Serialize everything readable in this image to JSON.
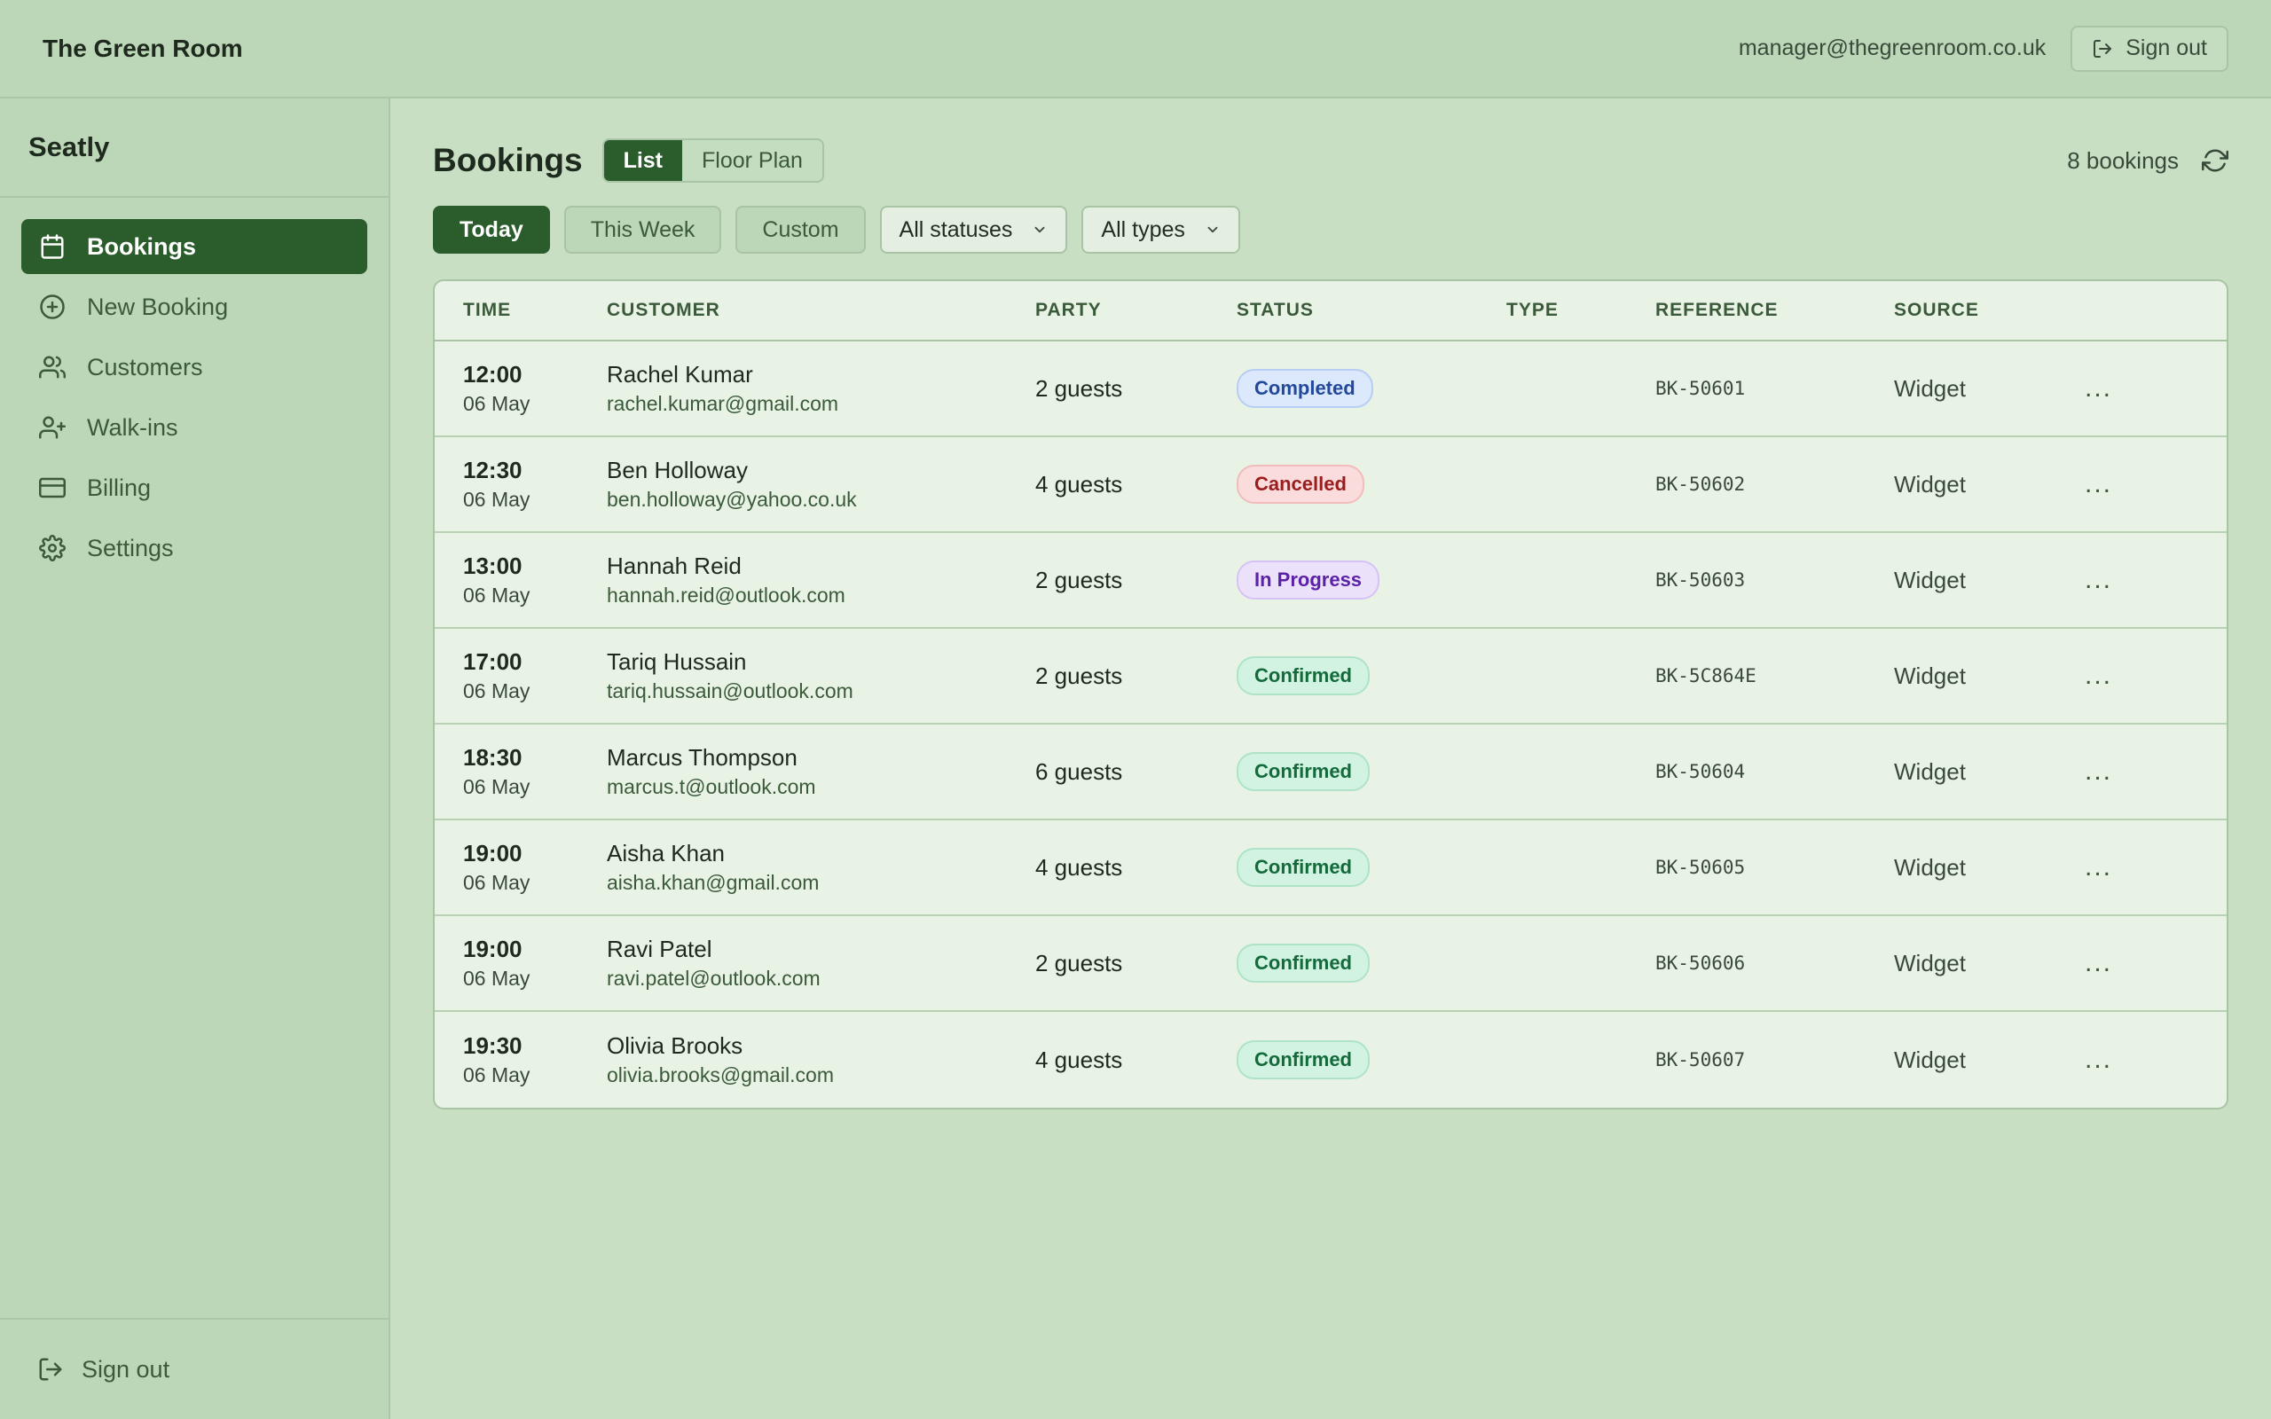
{
  "topbar": {
    "brand": "The Green Room",
    "user_email": "manager@thegreenroom.co.uk",
    "sign_out": "Sign out"
  },
  "sidebar": {
    "app_name": "Seatly",
    "items": [
      {
        "label": "Bookings",
        "icon": "calendar-icon",
        "active": true
      },
      {
        "label": "New Booking",
        "icon": "plus-circle-icon"
      },
      {
        "label": "Customers",
        "icon": "users-icon"
      },
      {
        "label": "Walk-ins",
        "icon": "user-plus-icon"
      },
      {
        "label": "Billing",
        "icon": "credit-card-icon"
      },
      {
        "label": "Settings",
        "icon": "gear-icon"
      }
    ],
    "sign_out": "Sign out"
  },
  "header": {
    "title": "Bookings",
    "views": [
      "List",
      "Floor Plan"
    ],
    "active_view": "List",
    "count": "8 bookings"
  },
  "filters": {
    "ranges": [
      "Today",
      "This Week",
      "Custom"
    ],
    "active_range": "Today",
    "status_select": "All statuses",
    "type_select": "All types"
  },
  "table": {
    "columns": [
      "TIME",
      "CUSTOMER",
      "PARTY",
      "STATUS",
      "TYPE",
      "REFERENCE",
      "SOURCE"
    ],
    "rows": [
      {
        "time": "12:00",
        "date": "06 May",
        "name": "Rachel Kumar",
        "email": "rachel.kumar@gmail.com",
        "party": "2 guests",
        "status": "Completed",
        "type": "",
        "ref": "BK-50601",
        "source": "Widget"
      },
      {
        "time": "12:30",
        "date": "06 May",
        "name": "Ben Holloway",
        "email": "ben.holloway@yahoo.co.uk",
        "party": "4 guests",
        "status": "Cancelled",
        "type": "",
        "ref": "BK-50602",
        "source": "Widget"
      },
      {
        "time": "13:00",
        "date": "06 May",
        "name": "Hannah Reid",
        "email": "hannah.reid@outlook.com",
        "party": "2 guests",
        "status": "In Progress",
        "type": "",
        "ref": "BK-50603",
        "source": "Widget"
      },
      {
        "time": "17:00",
        "date": "06 May",
        "name": "Tariq Hussain",
        "email": "tariq.hussain@outlook.com",
        "party": "2 guests",
        "status": "Confirmed",
        "type": "",
        "ref": "BK-5C864E",
        "source": "Widget"
      },
      {
        "time": "18:30",
        "date": "06 May",
        "name": "Marcus Thompson",
        "email": "marcus.t@outlook.com",
        "party": "6 guests",
        "status": "Confirmed",
        "type": "",
        "ref": "BK-50604",
        "source": "Widget"
      },
      {
        "time": "19:00",
        "date": "06 May",
        "name": "Aisha Khan",
        "email": "aisha.khan@gmail.com",
        "party": "4 guests",
        "status": "Confirmed",
        "type": "",
        "ref": "BK-50605",
        "source": "Widget"
      },
      {
        "time": "19:00",
        "date": "06 May",
        "name": "Ravi Patel",
        "email": "ravi.patel@outlook.com",
        "party": "2 guests",
        "status": "Confirmed",
        "type": "",
        "ref": "BK-50606",
        "source": "Widget"
      },
      {
        "time": "19:30",
        "date": "06 May",
        "name": "Olivia Brooks",
        "email": "olivia.brooks@gmail.com",
        "party": "4 guests",
        "status": "Confirmed",
        "type": "",
        "ref": "BK-50607",
        "source": "Widget"
      }
    ],
    "row_action": "..."
  },
  "colors": {
    "accent": "#2b5c2b",
    "background": "#c8dfc4",
    "surface": "#e8f2e5",
    "completed": "#234a9a",
    "cancelled": "#9b1c1c",
    "in_progress": "#5b22a5",
    "confirmed": "#136a3a"
  }
}
